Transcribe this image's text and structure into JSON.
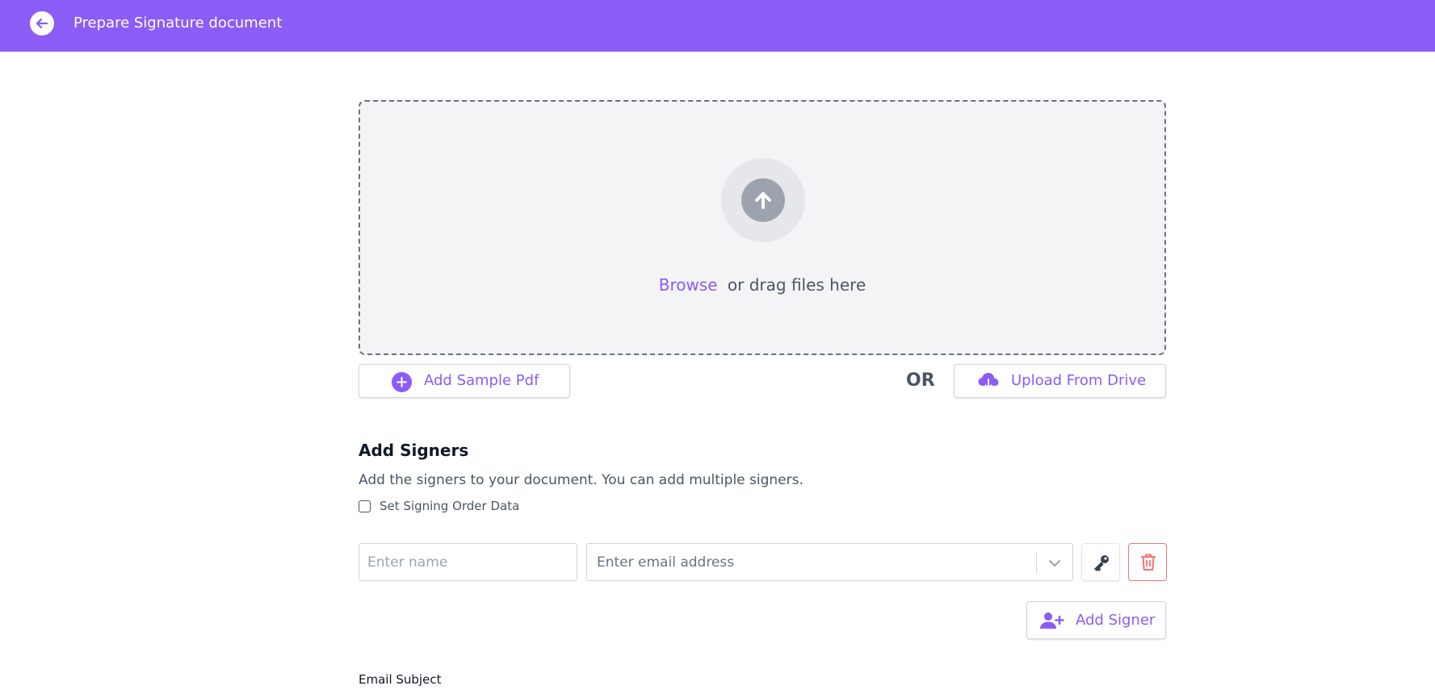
{
  "header": {
    "title": "Prepare Signature document",
    "back_icon": "arrow-left-icon",
    "background": "#8b5cf6"
  },
  "upload": {
    "icon": "arrow-up-icon",
    "browse_label": "Browse",
    "drag_label": "or drag files here",
    "sample_button_label": "Add Sample Pdf",
    "sample_button_icon": "plus-circle-icon",
    "or_label": "OR",
    "drive_button_label": "Upload From Drive",
    "drive_button_icon": "cloud-download-icon"
  },
  "signers": {
    "title": "Add Signers",
    "description": "Add the signers to your document. You can add multiple signers.",
    "signing_order_label": "Set Signing Order Data",
    "signing_order_checked": false,
    "rows": [
      {
        "name_placeholder": "Enter name",
        "name_value": "",
        "email_placeholder": "Enter email address",
        "key_icon": "key-icon",
        "delete_icon": "trash-icon"
      }
    ],
    "add_button_label": "Add Signer",
    "add_button_icon": "user-plus-icon"
  },
  "email": {
    "subject_label": "Email Subject"
  },
  "colors": {
    "accent": "#8b5cf6",
    "danger": "#f87171",
    "dropzone_bg": "#f3f4f6"
  }
}
